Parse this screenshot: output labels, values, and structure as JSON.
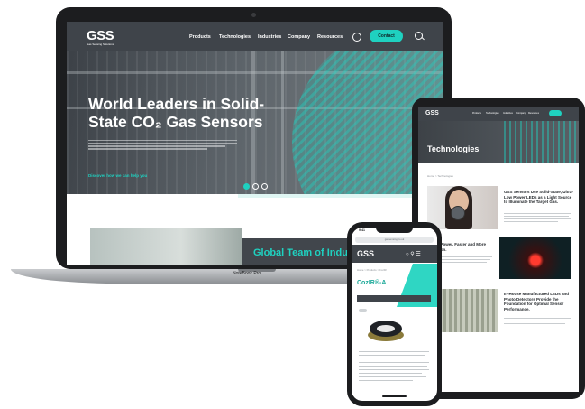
{
  "laptop": {
    "logo": "GSS",
    "logo_tagline": "Gas Sensing Solutions",
    "nav": [
      "Products",
      "Technologies",
      "Industries",
      "Company",
      "Resources"
    ],
    "contact_label": "Contact",
    "hero_title_line1": "World Leaders in Solid-",
    "hero_title_line2": "State CO₂ Gas Sensors",
    "hero_link": "Discover how we can help you",
    "card_title": "Global Team of Indus",
    "brand": "NoteBook Pro"
  },
  "tablet": {
    "logo": "GSS",
    "nav": [
      "Products",
      "Technologies",
      "Industries",
      "Company",
      "Resources"
    ],
    "page_title": "Technologies",
    "breadcrumb": "Home  >  Technologies",
    "item1_title": "GSS Sensors Use Solid-State, Ultra-Low Power LEDs as a Light Source to Illuminate the Target Gas.",
    "item2_title": "Lower Power, Faster and More Precision.",
    "item3_title": "In-House Manufactured LEDs and Photo Detectors Provide the Foundation for Optimal Sensor Performance."
  },
  "phone": {
    "time": "9:41",
    "url": "gassensing.co.uk",
    "logo": "GSS",
    "breadcrumb": "Home  >  Products  >  CozIR",
    "product_title": "CozIR®-A"
  },
  "colors": {
    "accent": "#1fd1c0",
    "nav_bg": "#3f444a",
    "device": "#1c1d1f"
  },
  "icons": [
    "globe-icon",
    "search-icon",
    "menu-icon"
  ]
}
